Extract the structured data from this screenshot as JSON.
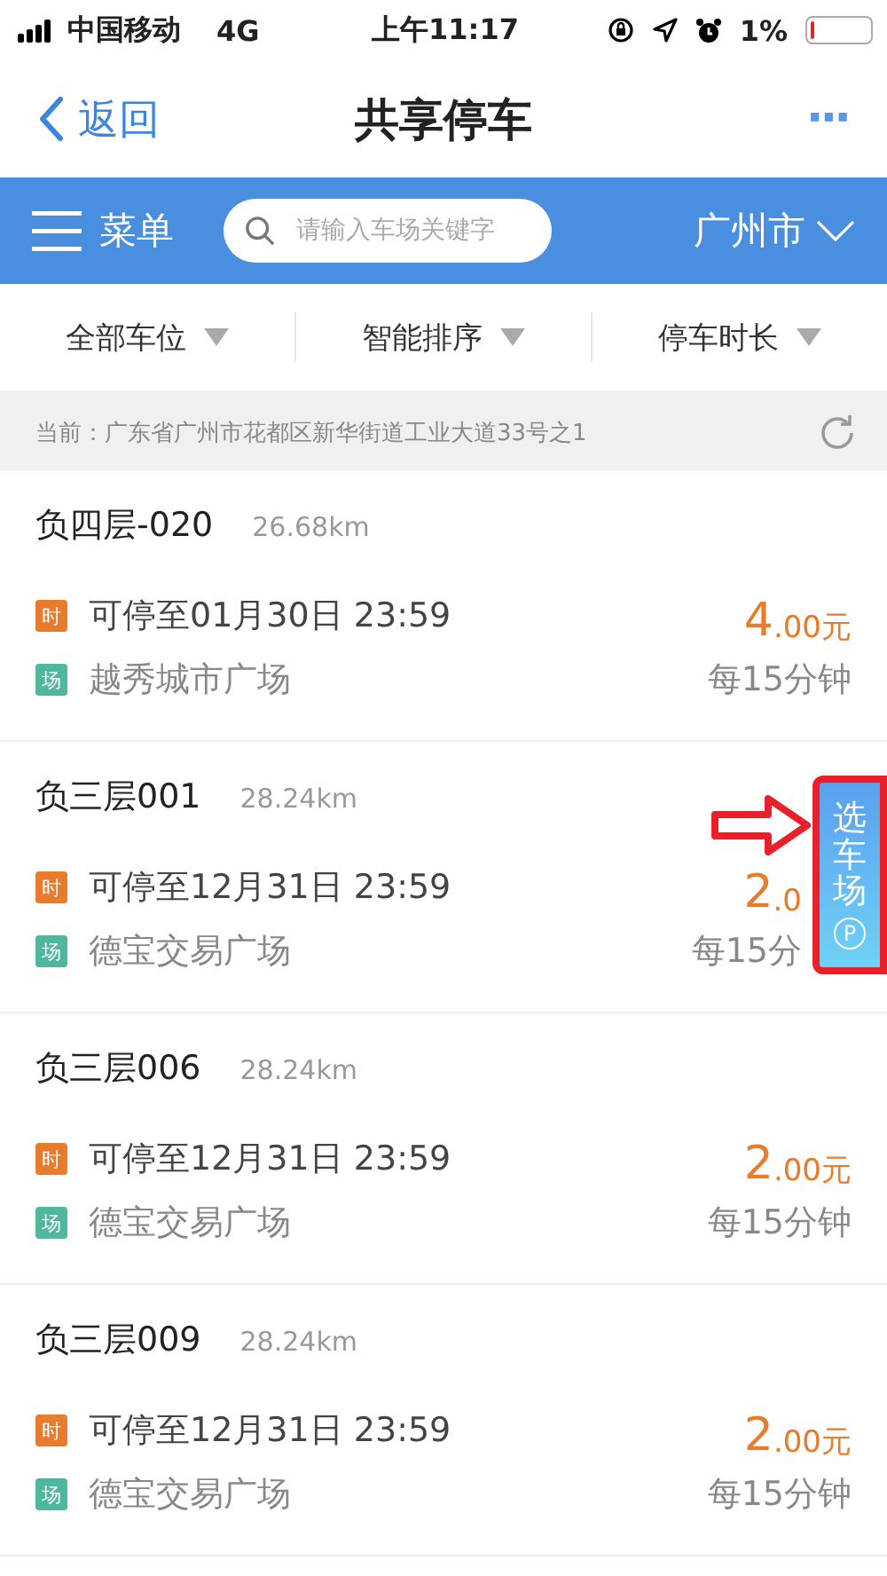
{
  "status_bar": {
    "carrier": "中国移动",
    "network": "4G",
    "time": "上午11:17",
    "battery": "1%"
  },
  "nav": {
    "back": "返回",
    "title": "共享停车",
    "more": "···"
  },
  "header": {
    "menu": "菜单",
    "search": {
      "placeholder": "请输入车场关键字"
    },
    "city": "广州市"
  },
  "filters": [
    {
      "label": "全部车位"
    },
    {
      "label": "智能排序"
    },
    {
      "label": "停车时长"
    }
  ],
  "location": "当前：广东省广州市花都区新华街道工业大道33号之1",
  "spots": [
    {
      "name": "负四层-020",
      "distance": "26.68km",
      "time_tag": "时",
      "until": "可停至01月30日 23:59",
      "site_tag": "场",
      "site": "越秀城市广场",
      "price": "4",
      "price_rest": ".00元",
      "per": "每15分钟"
    },
    {
      "name": "负三层001",
      "distance": "28.24km",
      "time_tag": "时",
      "until": "可停至12月31日 23:59",
      "site_tag": "场",
      "site": "德宝交易广场",
      "price": "2",
      "price_rest": ".0",
      "per": "每15分"
    },
    {
      "name": "负三层006",
      "distance": "28.24km",
      "time_tag": "时",
      "until": "可停至12月31日 23:59",
      "site_tag": "场",
      "site": "德宝交易广场",
      "price": "2",
      "price_rest": ".00元",
      "per": "每15分钟"
    },
    {
      "name": "负三层009",
      "distance": "28.24km",
      "time_tag": "时",
      "until": "可停至12月31日 23:59",
      "site_tag": "场",
      "site": "德宝交易广场",
      "price": "2",
      "price_rest": ".00元",
      "per": "每15分钟"
    }
  ],
  "float_button": {
    "label": "选车场",
    "badge": "P"
  }
}
